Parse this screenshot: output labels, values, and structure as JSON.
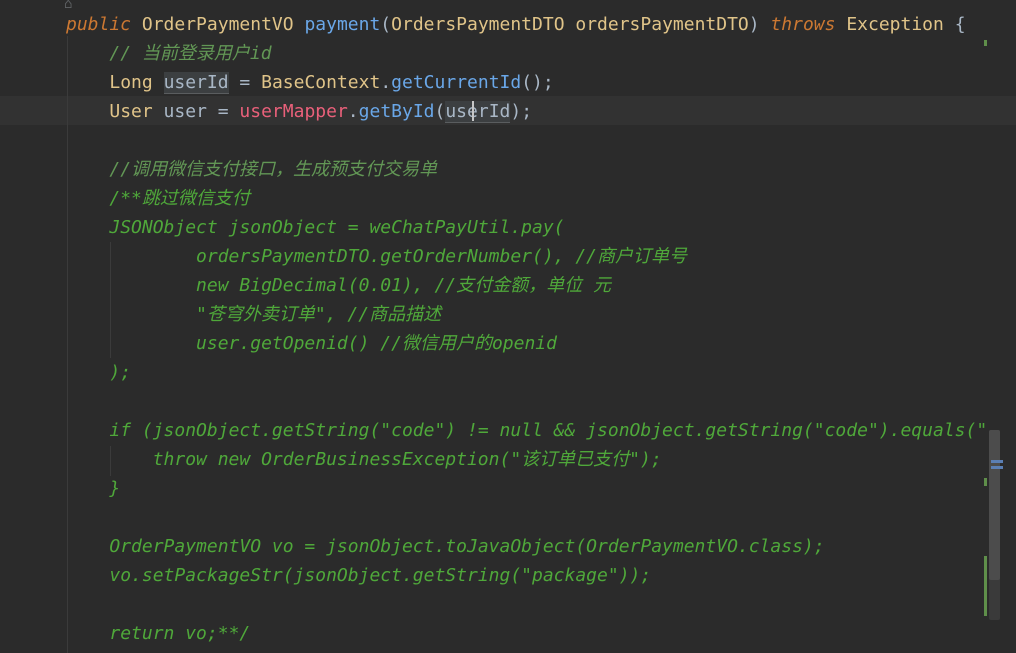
{
  "editor": {
    "lines": [
      [
        {
          "t": "public",
          "c": "kw-em"
        },
        {
          "t": " "
        },
        {
          "t": "OrderPaymentVO",
          "c": "cls"
        },
        {
          "t": " "
        },
        {
          "t": "payment",
          "c": "meth"
        },
        {
          "t": "("
        },
        {
          "t": "OrdersPaymentDTO",
          "c": "cls"
        },
        {
          "t": " "
        },
        {
          "t": "ordersPaymentDTO",
          "c": "param"
        },
        {
          "t": ") "
        },
        {
          "t": "throws",
          "c": "kw-em"
        },
        {
          "t": " "
        },
        {
          "t": "Exception",
          "c": "cls"
        },
        {
          "t": " {"
        }
      ],
      [
        {
          "t": "    "
        },
        {
          "t": "// 当前登录用户id",
          "c": "cmt"
        }
      ],
      [
        {
          "t": "    "
        },
        {
          "t": "Long",
          "c": "cls"
        },
        {
          "t": " "
        },
        {
          "t": "userId",
          "c": "var-hl"
        },
        {
          "t": " = "
        },
        {
          "t": "BaseContext",
          "c": "cls"
        },
        {
          "t": "."
        },
        {
          "t": "getCurrentId",
          "c": "meth"
        },
        {
          "t": "();"
        }
      ],
      [
        {
          "t": "    "
        },
        {
          "t": "User",
          "c": "cls"
        },
        {
          "t": " user = "
        },
        {
          "t": "userMapper",
          "c": "fld"
        },
        {
          "t": "."
        },
        {
          "t": "getById",
          "c": "meth"
        },
        {
          "t": "("
        },
        {
          "t": "userId",
          "c": "var-hl"
        },
        {
          "t": ");"
        }
      ],
      [],
      [
        {
          "t": "    "
        },
        {
          "t": "//调用微信支付接口，生成预支付交易单",
          "c": "cmt"
        }
      ],
      [
        {
          "t": "    "
        },
        {
          "t": "/**跳过微信支付",
          "c": "dead"
        }
      ],
      [
        {
          "t": "    "
        },
        {
          "t": "JSONObject jsonObject = weChatPayUtil.pay(",
          "c": "dead"
        }
      ],
      [
        {
          "t": "            "
        },
        {
          "t": "ordersPaymentDTO.getOrderNumber(), //商户订单号",
          "c": "dead"
        }
      ],
      [
        {
          "t": "            "
        },
        {
          "t": "new BigDecimal(0.01), //支付金额，单位 元",
          "c": "dead"
        }
      ],
      [
        {
          "t": "            "
        },
        {
          "t": "\"苍穹外卖订单\", //商品描述",
          "c": "dead"
        }
      ],
      [
        {
          "t": "            "
        },
        {
          "t": "user.getOpenid() //微信用户的openid",
          "c": "dead"
        }
      ],
      [
        {
          "t": "    "
        },
        {
          "t": ");",
          "c": "dead"
        }
      ],
      [],
      [
        {
          "t": "    "
        },
        {
          "t": "if (jsonObject.getString(\"code\") != null && jsonObject.getString(\"code\").equals(\"",
          "c": "dead"
        }
      ],
      [
        {
          "t": "        "
        },
        {
          "t": "throw new OrderBusinessException(\"该订单已支付\");",
          "c": "dead"
        }
      ],
      [
        {
          "t": "    "
        },
        {
          "t": "}",
          "c": "dead"
        }
      ],
      [],
      [
        {
          "t": "    "
        },
        {
          "t": "OrderPaymentVO vo = jsonObject.toJavaObject(OrderPaymentVO.class);",
          "c": "dead"
        }
      ],
      [
        {
          "t": "    "
        },
        {
          "t": "vo.setPackageStr(jsonObject.getString(\"package\"));",
          "c": "dead"
        }
      ],
      [],
      [
        {
          "t": "    "
        },
        {
          "t": "return vo;**/",
          "c": "dead"
        }
      ]
    ]
  },
  "colors": {
    "background": "#2b2b2b",
    "current_line": "#323232",
    "keyword": "#cc7832",
    "class": "#e0c489",
    "method": "#6aa7e8",
    "field": "#e9607a",
    "comment": "#629755",
    "commented_code": "#4fa83a"
  }
}
